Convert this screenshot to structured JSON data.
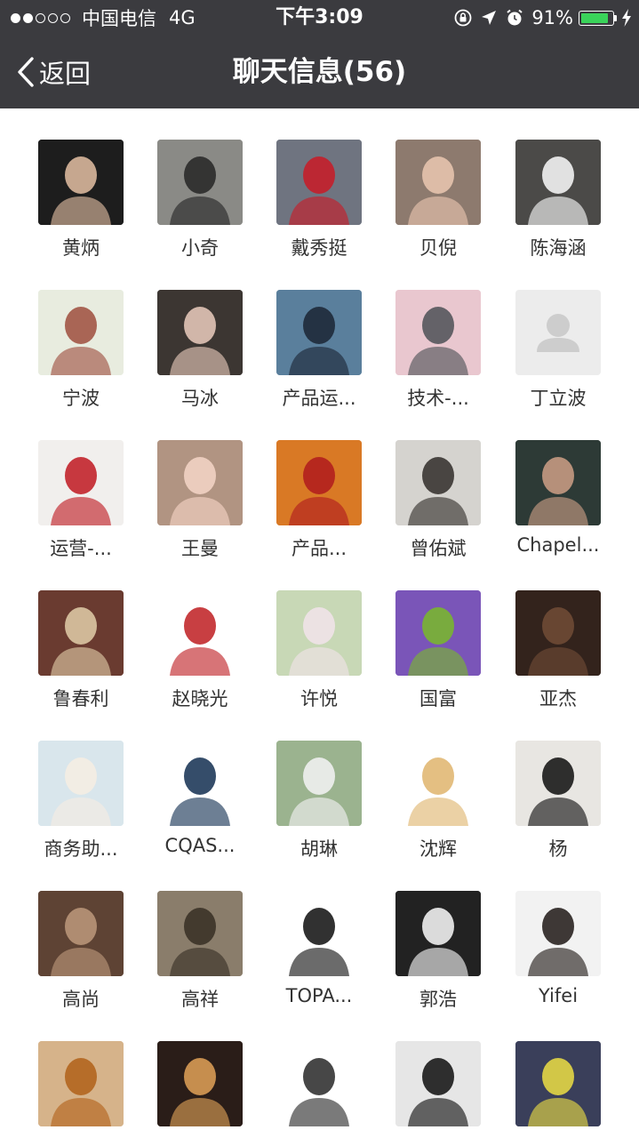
{
  "status_bar": {
    "signal_filled": 2,
    "signal_total": 5,
    "carrier": "中国电信",
    "network": "4G",
    "time": "下午3:09",
    "battery_percent": "91%",
    "battery_level": 0.91,
    "icons": [
      "orientation-lock-icon",
      "location-icon",
      "alarm-icon",
      "charging-icon"
    ]
  },
  "nav": {
    "back_label": "返回",
    "title": "聊天信息(56)"
  },
  "members": [
    {
      "name": "黄炳",
      "avatar": "photo",
      "bg": "#1d1d1d",
      "fg": "#d9b79c"
    },
    {
      "name": "小奇",
      "avatar": "photo",
      "bg": "#8a8a86",
      "fg": "#2a2a2a"
    },
    {
      "name": "戴秀挺",
      "avatar": "photo",
      "bg": "#6f7480",
      "fg": "#c41f2a"
    },
    {
      "name": "贝倪",
      "avatar": "photo",
      "bg": "#8d7a6e",
      "fg": "#e6c3ad"
    },
    {
      "name": "陈海涵",
      "avatar": "photo",
      "bg": "#4b4a48",
      "fg": "#f2f2f2"
    },
    {
      "name": "宁波",
      "avatar": "photo",
      "bg": "#e8ecdf",
      "fg": "#a25646"
    },
    {
      "name": "马冰",
      "avatar": "photo",
      "bg": "#3c3632",
      "fg": "#e1c4b6"
    },
    {
      "name": "产品运...",
      "avatar": "photo",
      "bg": "#5a7f9c",
      "fg": "#1e2a3a"
    },
    {
      "name": "技术-...",
      "avatar": "photo",
      "bg": "#e9c7cf",
      "fg": "#55575c"
    },
    {
      "name": "丁立波",
      "avatar": "default",
      "bg": "#ececec",
      "fg": "#cdcdcd"
    },
    {
      "name": "运营-...",
      "avatar": "photo",
      "bg": "#f1efed",
      "fg": "#c2232b"
    },
    {
      "name": "王曼",
      "avatar": "photo",
      "bg": "#b19482",
      "fg": "#f2d1c3"
    },
    {
      "name": "产品...",
      "avatar": "photo",
      "bg": "#d97925",
      "fg": "#b11f1e"
    },
    {
      "name": "曾佑斌",
      "avatar": "photo",
      "bg": "#d5d3cf",
      "fg": "#3a3532"
    },
    {
      "name": "Chapel...",
      "avatar": "photo",
      "bg": "#2d3a36",
      "fg": "#c59a82"
    },
    {
      "name": "鲁春利",
      "avatar": "photo",
      "bg": "#6a3b30",
      "fg": "#dcc6a3"
    },
    {
      "name": "赵晓光",
      "avatar": "photo",
      "bg": "#ffffff",
      "fg": "#c22a2e"
    },
    {
      "name": "许悦",
      "avatar": "photo",
      "bg": "#c8d8b6",
      "fg": "#efe3e8"
    },
    {
      "name": "国富",
      "avatar": "photo",
      "bg": "#7a55b8",
      "fg": "#79b531"
    },
    {
      "name": "亚杰",
      "avatar": "photo",
      "bg": "#33231c",
      "fg": "#6e4a35"
    },
    {
      "name": "商务助...",
      "avatar": "photo",
      "bg": "#d9e6ec",
      "fg": "#f4ede3"
    },
    {
      "name": "CQAS...",
      "avatar": "photo",
      "bg": "#ffffff",
      "fg": "#1f3a5a"
    },
    {
      "name": "胡琳",
      "avatar": "photo",
      "bg": "#9bb38f",
      "fg": "#f0f0f0"
    },
    {
      "name": "沈辉",
      "avatar": "photo",
      "bg": "#ffffff",
      "fg": "#e1b874"
    },
    {
      "name": "杨",
      "avatar": "photo",
      "bg": "#e8e6e2",
      "fg": "#1a1a1a"
    },
    {
      "name": "高尚",
      "avatar": "photo",
      "bg": "#5e4334",
      "fg": "#b89578"
    },
    {
      "name": "高祥",
      "avatar": "photo",
      "bg": "#8a7d6b",
      "fg": "#3b3328"
    },
    {
      "name": "TOPA...",
      "avatar": "photo",
      "bg": "#ffffff",
      "fg": "#1b1b1b"
    },
    {
      "name": "郭浩",
      "avatar": "photo",
      "bg": "#222222",
      "fg": "#f0f0f0"
    },
    {
      "name": "Yifei",
      "avatar": "photo",
      "bg": "#f2f2f2",
      "fg": "#2a2421"
    },
    {
      "name": "",
      "avatar": "photo",
      "bg": "#d6b38a",
      "fg": "#b3651e"
    },
    {
      "name": "",
      "avatar": "photo",
      "bg": "#2a1d18",
      "fg": "#d79b54"
    },
    {
      "name": "",
      "avatar": "photo",
      "bg": "#ffffff",
      "fg": "#333333"
    },
    {
      "name": "",
      "avatar": "photo",
      "bg": "#e6e6e6",
      "fg": "#1a1a1a"
    },
    {
      "name": "",
      "avatar": "photo",
      "bg": "#3a3f5a",
      "fg": "#e3d645"
    }
  ]
}
